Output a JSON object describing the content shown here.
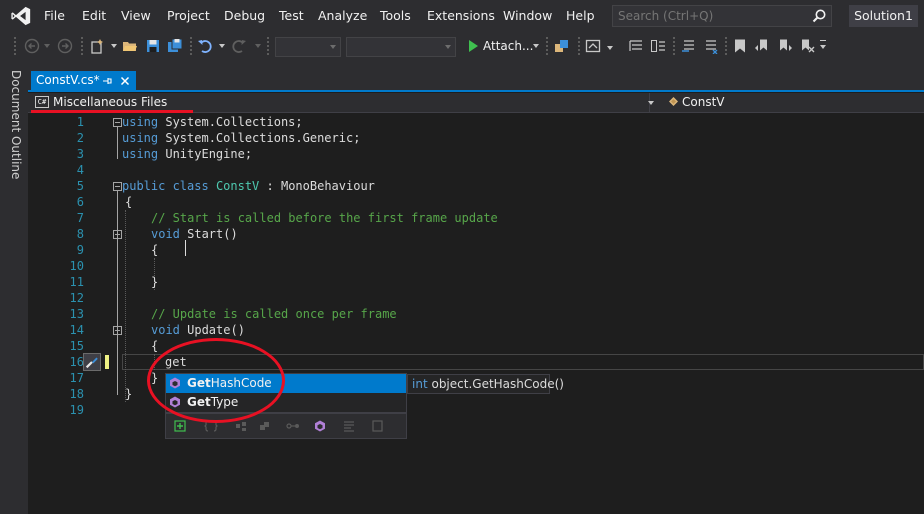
{
  "menu": {
    "items": [
      "File",
      "Edit",
      "View",
      "Project",
      "Debug",
      "Test",
      "Analyze",
      "Tools",
      "Extensions",
      "Window",
      "Help"
    ],
    "search_placeholder": "Search (Ctrl+Q)",
    "solution_name": "Solution1"
  },
  "toolbar": {
    "attach_label": "Attach...",
    "icons": [
      "back-icon",
      "forward-icon",
      "new-project-icon",
      "open-folder-icon",
      "save-icon",
      "save-all-icon",
      "undo-icon",
      "redo-icon",
      "start-icon",
      "toolbox-icon",
      "browser-icon",
      "bookmark-icon"
    ]
  },
  "side_panel": {
    "label": "Document Outline"
  },
  "tab": {
    "title": "ConstV.cs*"
  },
  "navbar": {
    "project": "Miscellaneous Files",
    "project_badge": "C#",
    "class_name": "ConstV"
  },
  "editor": {
    "line_numbers": [
      "1",
      "2",
      "3",
      "4",
      "5",
      "6",
      "7",
      "8",
      "9",
      "10",
      "11",
      "12",
      "13",
      "14",
      "15",
      "16",
      "17",
      "18",
      "19"
    ],
    "lines": {
      "l1_kw": "using",
      "l1_rest": " System.Collections;",
      "l2_kw": "using",
      "l2_rest": " System.Collections.Generic;",
      "l3_kw": "using",
      "l3_rest": " UnityEngine;",
      "l5_kw": "public class",
      "l5_type": "ConstV",
      "l5_sep": " : ",
      "l5_base": "MonoBehaviour",
      "l6": "{",
      "l7": "// Start is called before the first frame update",
      "l8_kw": "void",
      "l8_rest": " Start()",
      "l9": "{",
      "l11": "}",
      "l13": "// Update is called once per frame",
      "l14_kw": "void",
      "l14_rest": " Update()",
      "l15": "{",
      "l16": "get",
      "l17": "}",
      "l18": "}"
    }
  },
  "intellisense": {
    "items": [
      {
        "match": "Get",
        "rest": "HashCode",
        "selected": true
      },
      {
        "match": "Get",
        "rest": "Type",
        "selected": false
      }
    ],
    "signature_kw": "int",
    "signature_rest": " object.GetHashCode()"
  },
  "colors": {
    "accent": "#007acc",
    "keyword": "#569cd6",
    "type": "#4ec9b0",
    "comment": "#57a64a",
    "line_number": "#2b91af",
    "annotation": "#e81123"
  }
}
